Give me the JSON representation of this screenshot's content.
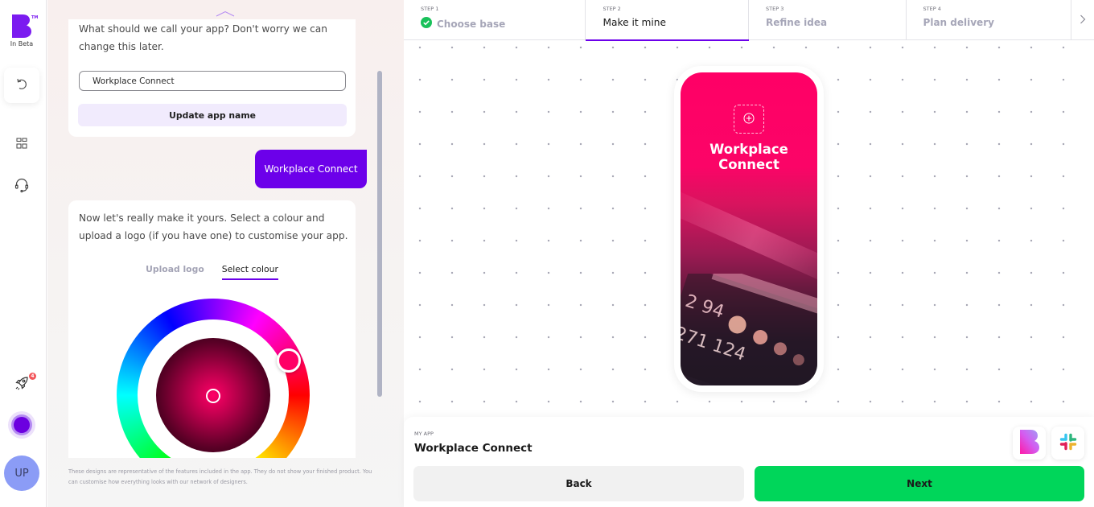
{
  "rail": {
    "logo_tm": "TM",
    "beta_label": "In Beta",
    "items": [
      {
        "name": "undo",
        "icon": "undo-icon"
      },
      {
        "name": "dashboard",
        "icon": "grid-icon"
      },
      {
        "name": "support",
        "icon": "headset-icon"
      },
      {
        "name": "launch",
        "icon": "rocket-icon",
        "badge": "4"
      }
    ],
    "theme_color": "#6c00e0",
    "avatar_initials": "UP"
  },
  "chat": {
    "name_prompt": "What should we call your app? Don't worry we can change this later.",
    "name_input_value": "Workplace Connect",
    "update_button": "Update app name",
    "user_reply": "Workplace Connect",
    "customise_prompt": "Now let's really make it yours. Select a colour and upload a logo (if you have one) to customise your app.",
    "tabs": [
      {
        "label": "Upload logo",
        "active": false
      },
      {
        "label": "Select colour",
        "active": true
      }
    ],
    "selected_color": "#ff0066",
    "disclaimer": "These designs are representative of the features included in the app. They do not show your finished product. You can customise how everything looks with our network of designers."
  },
  "steps": [
    {
      "number": "STEP 1",
      "label": "Choose base",
      "status": "complete"
    },
    {
      "number": "STEP 2",
      "label": "Make it mine",
      "status": "active"
    },
    {
      "number": "STEP 3",
      "label": "Refine idea",
      "status": "upcoming"
    },
    {
      "number": "STEP 4",
      "label": "Plan delivery",
      "status": "upcoming"
    }
  ],
  "preview": {
    "app_title": "Workplace Connect",
    "brand_color": "#ff0066"
  },
  "footer": {
    "my_app_label": "MY APP",
    "app_name": "Workplace Connect",
    "integrations": [
      "builder-logo",
      "slack-logo"
    ],
    "back_button": "Back",
    "next_button": "Next"
  },
  "colors": {
    "accent": "#6c00ea",
    "next_green": "#00d65a",
    "complete_green": "#19c15a"
  }
}
